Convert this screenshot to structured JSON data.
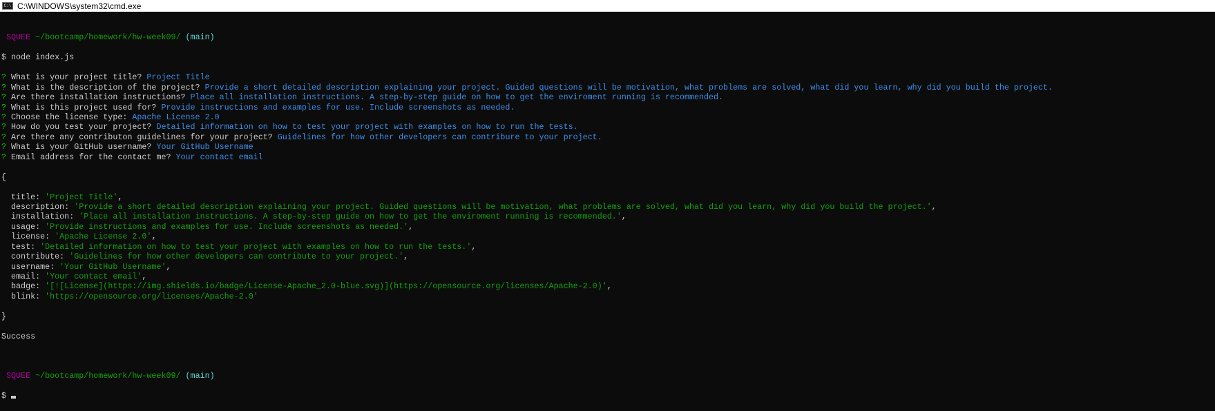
{
  "window": {
    "title": "C:\\WINDOWS\\system32\\cmd.exe"
  },
  "prompt": {
    "user": "SQUEE",
    "path": "~/bootcamp/homework/hw-week09/",
    "branch": "(main)",
    "symbol": "$"
  },
  "command": "node index.js",
  "questions": [
    {
      "q": "What is your project title?",
      "a": "Project Title"
    },
    {
      "q": "What is the description of the project?",
      "a": "Provide a short detailed description explaining your project. Guided questions will be motivation, what problems are solved, what did you learn, why did you build the project."
    },
    {
      "q": "Are there installation instructions?",
      "a": "Place all installation instructions. A step-by-step guide on how to get the enviroment running is recommended."
    },
    {
      "q": "What is this project used for?",
      "a": "Provide instructions and examples for use. Include screenshots as needed."
    },
    {
      "q": "Choose the license type:",
      "a": "Apache License 2.0"
    },
    {
      "q": "How do you test your project?",
      "a": "Detailed information on how to test your project with examples on how to run the tests."
    },
    {
      "q": "Are there any contributon guidelines for your project?",
      "a": "Guidelines for how other developers can contribure to your project."
    },
    {
      "q": "What is your GitHub username?",
      "a": "Your GitHub Username"
    },
    {
      "q": "Email address for the contact me?",
      "a": "Your contact email"
    }
  ],
  "object": [
    {
      "k": "title",
      "v": "'Project Title'"
    },
    {
      "k": "description",
      "v": "'Provide a short detailed description explaining your project. Guided questions will be motivation, what problems are solved, what did you learn, why did you build the project.'"
    },
    {
      "k": "installation",
      "v": "'Place all installation instructions. A step-by-step guide on how to get the enviroment running is recommended.'"
    },
    {
      "k": "usage",
      "v": "'Provide instructions and examples for use. Include screenshots as needed.'"
    },
    {
      "k": "license",
      "v": "'Apache License 2.0'"
    },
    {
      "k": "test",
      "v": "'Detailed information on how to test your project with examples on how to run the tests.'"
    },
    {
      "k": "contribute",
      "v": "'Guidelines for how other developers can contribute to your project.'"
    },
    {
      "k": "username",
      "v": "'Your GitHub Username'"
    },
    {
      "k": "email",
      "v": "'Your contact email'"
    },
    {
      "k": "badge",
      "v": "'[![License](https://img.shields.io/badge/License-Apache_2.0-blue.svg)](https://opensource.org/licenses/Apache-2.0)'"
    },
    {
      "k": "blink",
      "v": "'https://opensource.org/licenses/Apache-2.0'"
    }
  ],
  "result": "Success"
}
